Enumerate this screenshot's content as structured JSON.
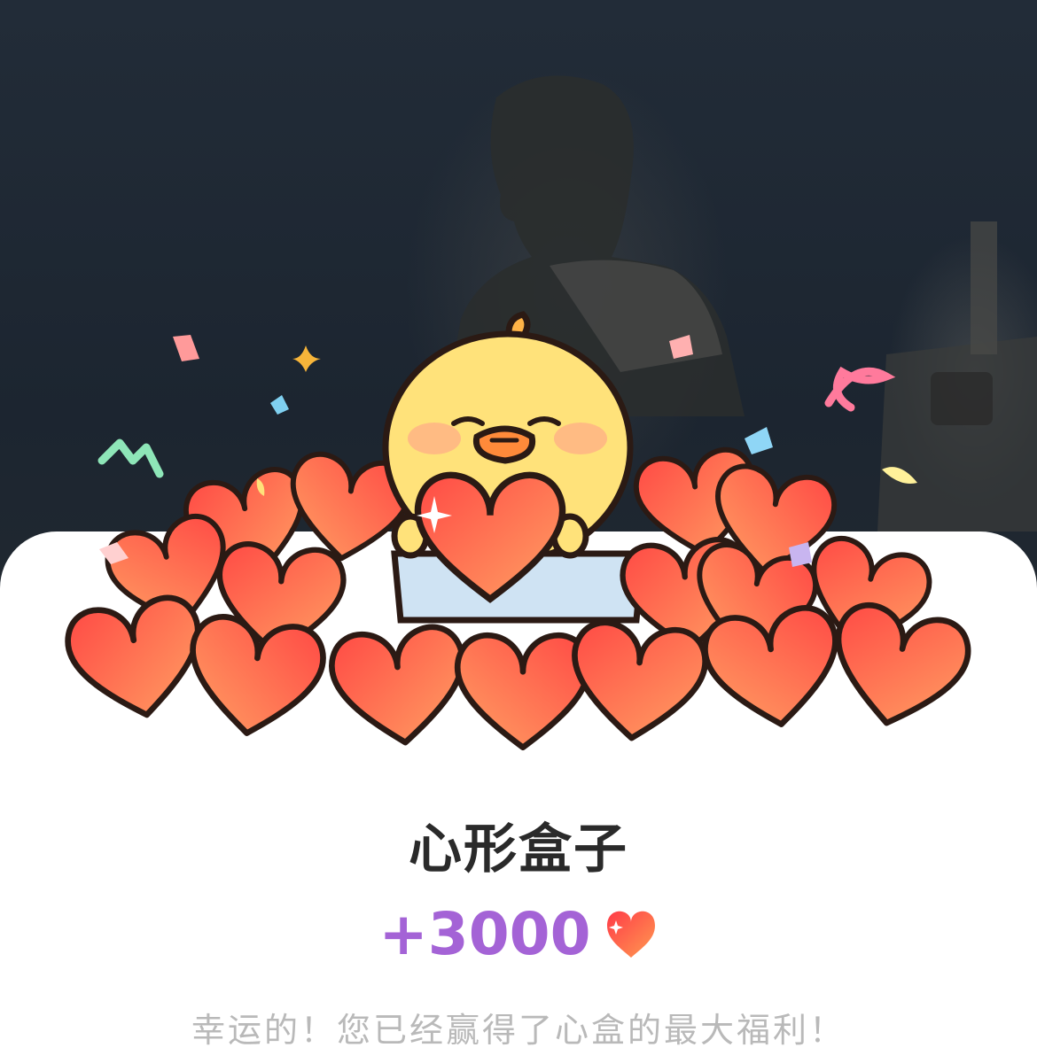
{
  "background": {
    "description_icon": "person-photo-background"
  },
  "card": {
    "title": "心形盒子",
    "reward_amount": "+3000",
    "reward_icon": "heart-icon",
    "message": "幸运的！您已经赢得了心盒的最大福利！"
  },
  "colors": {
    "accent": "#a463d6",
    "heart_light": "#ffa063",
    "heart_dark": "#ff4a45",
    "title": "#2a2a2a",
    "message": "#b9b9b9"
  }
}
